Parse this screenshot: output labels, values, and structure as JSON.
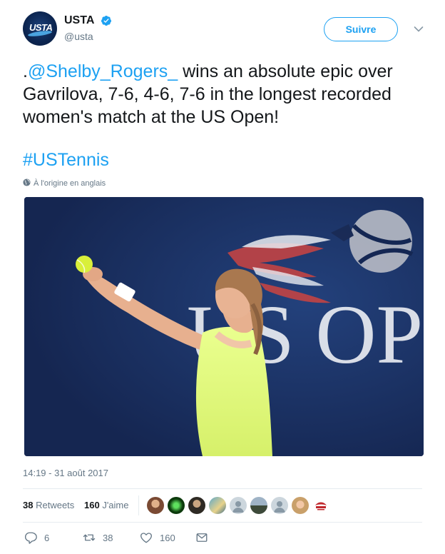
{
  "account": {
    "display_name": "USTA",
    "handle": "@usta",
    "avatar_text": "USTA"
  },
  "follow_label": "Suivre",
  "tweet": {
    "prefix": ".",
    "mention": "@Shelby_Rogers_",
    "body": " wins an absolute epic over Gavrilova, 7-6, 4-6, 7-6 in the longest recorded women's match at the US Open!",
    "hashtag": "#USTennis",
    "translation_note": "À l'origine en anglais"
  },
  "photo": {
    "backdrop_text": "US OPEN"
  },
  "timestamp": "14:19 - 31 août 2017",
  "stats": {
    "retweets_count": "38",
    "retweets_label": "Retweets",
    "likes_count": "160",
    "likes_label": "J'aime"
  },
  "actions": {
    "reply_count": "6",
    "retweet_count": "38",
    "like_count": "160"
  },
  "colors": {
    "accent": "#1da1f2",
    "text": "#14171a",
    "muted": "#657786",
    "border": "#e6ecf0"
  },
  "icons": [
    "verified-badge-icon",
    "chevron-down-icon",
    "globe-icon",
    "reply-icon",
    "retweet-icon",
    "heart-icon",
    "message-icon"
  ]
}
